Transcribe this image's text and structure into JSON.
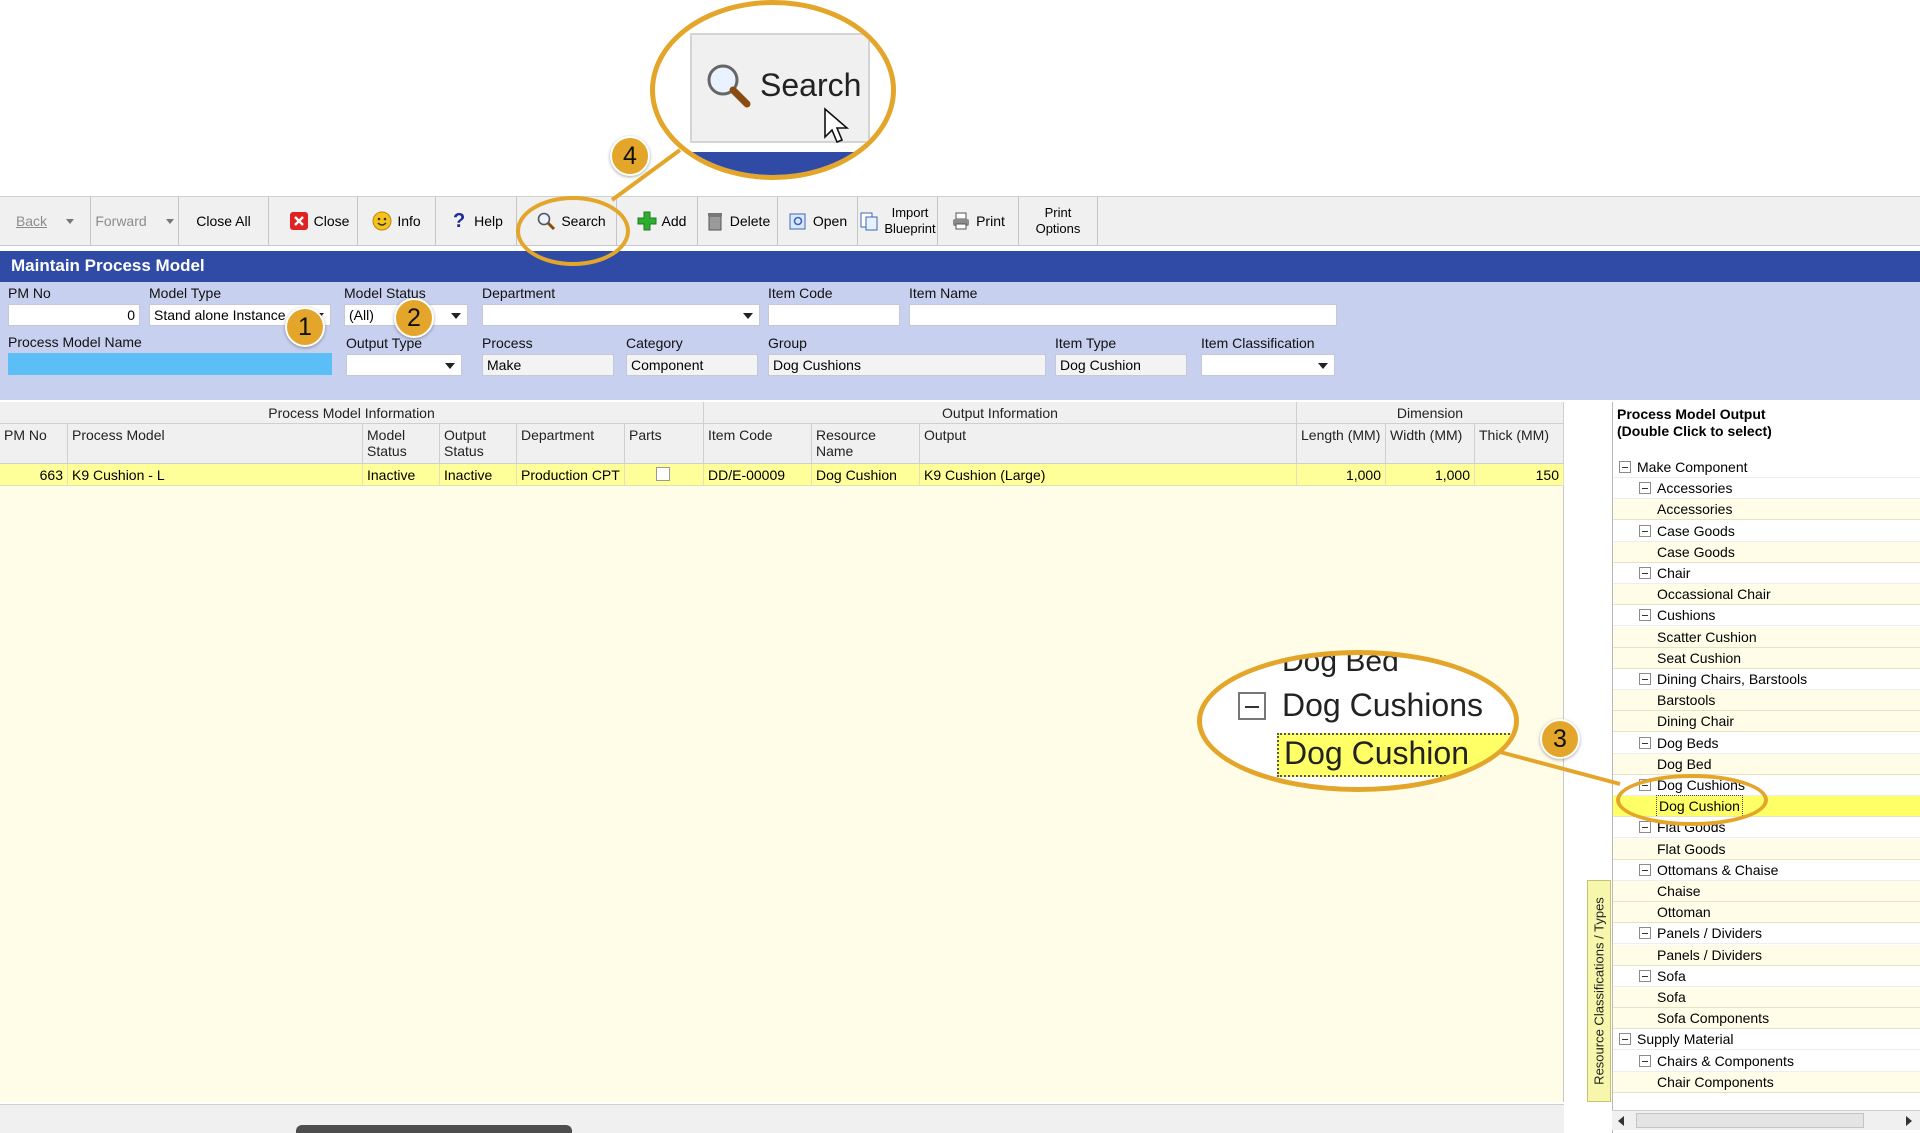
{
  "toolbar": {
    "back": "Back",
    "forward": "Forward",
    "close_all": "Close All",
    "close": "Close",
    "info": "Info",
    "help": "Help",
    "search": "Search",
    "add": "Add",
    "delete": "Delete",
    "open": "Open",
    "import_blueprint": [
      "Import",
      "Blueprint"
    ],
    "print": "Print",
    "print_options": [
      "Print",
      "Options"
    ]
  },
  "window_title": "Maintain Process Model",
  "filters": {
    "pm_no": {
      "label": "PM No",
      "value": "0"
    },
    "model_type": {
      "label": "Model Type",
      "value": "Stand alone Instance"
    },
    "model_status": {
      "label": "Model Status",
      "value": "(All)"
    },
    "department": {
      "label": "Department",
      "value": ""
    },
    "item_code": {
      "label": "Item Code",
      "value": ""
    },
    "item_name": {
      "label": "Item Name",
      "value": ""
    },
    "process_model_name": {
      "label": "Process Model Name",
      "value": ""
    },
    "output_type": {
      "label": "Output Type",
      "value": ""
    },
    "process": {
      "label": "Process",
      "value": "Make"
    },
    "category": {
      "label": "Category",
      "value": "Component"
    },
    "group": {
      "label": "Group",
      "value": "Dog Cushions"
    },
    "item_type": {
      "label": "Item Type",
      "value": "Dog Cushion"
    },
    "item_classification": {
      "label": "Item Classification",
      "value": ""
    }
  },
  "grid": {
    "band_headers": [
      "Process Model Information",
      "Output Information",
      "Dimension"
    ],
    "columns": [
      [
        "PM No"
      ],
      [
        "Process Model"
      ],
      [
        "Model",
        "Status"
      ],
      [
        "Output",
        "Status"
      ],
      [
        "Department"
      ],
      [
        "Parts"
      ],
      [
        "Item Code"
      ],
      [
        "Resource",
        "Name"
      ],
      [
        "Output"
      ],
      [
        "Length (MM)"
      ],
      [
        "Width (MM)"
      ],
      [
        "Thick (MM)"
      ]
    ],
    "rows": [
      {
        "pm_no": "663",
        "process_model": "K9 Cushion - L",
        "model_status": "Inactive",
        "output_status": "Inactive",
        "department": "Production CPT",
        "parts": false,
        "item_code": "DD/E-00009",
        "resource_name": "Dog Cushion",
        "output": "K9 Cushion (Large)",
        "length": "1,000",
        "width": "1,000",
        "thick": "150"
      }
    ]
  },
  "side_tab": "Resource Classifications / Types",
  "tree": {
    "title": [
      "Process Model Output",
      "(Double Click to select)"
    ],
    "nodes": [
      {
        "label": "Make Component",
        "level": 0,
        "type": "group"
      },
      {
        "label": "Accessories",
        "level": 1,
        "type": "group"
      },
      {
        "label": "Accessories",
        "level": 2,
        "type": "leaf"
      },
      {
        "label": "Case Goods",
        "level": 1,
        "type": "group"
      },
      {
        "label": "Case Goods",
        "level": 2,
        "type": "leaf"
      },
      {
        "label": "Chair",
        "level": 1,
        "type": "group"
      },
      {
        "label": "Occassional Chair",
        "level": 2,
        "type": "leaf"
      },
      {
        "label": "Cushions",
        "level": 1,
        "type": "group"
      },
      {
        "label": "Scatter Cushion",
        "level": 2,
        "type": "leaf"
      },
      {
        "label": "Seat Cushion",
        "level": 2,
        "type": "leaf"
      },
      {
        "label": "Dining Chairs, Barstools",
        "level": 1,
        "type": "group"
      },
      {
        "label": "Barstools",
        "level": 2,
        "type": "leaf"
      },
      {
        "label": "Dining Chair",
        "level": 2,
        "type": "leaf"
      },
      {
        "label": "Dog Beds",
        "level": 1,
        "type": "group"
      },
      {
        "label": "Dog Bed",
        "level": 2,
        "type": "leaf"
      },
      {
        "label": "Dog Cushions",
        "level": 1,
        "type": "group"
      },
      {
        "label": "Dog Cushion",
        "level": 2,
        "type": "leaf",
        "selected": true
      },
      {
        "label": "Flat Goods",
        "level": 1,
        "type": "group"
      },
      {
        "label": "Flat Goods",
        "level": 2,
        "type": "leaf"
      },
      {
        "label": "Ottomans & Chaise",
        "level": 1,
        "type": "group"
      },
      {
        "label": "Chaise",
        "level": 2,
        "type": "leaf"
      },
      {
        "label": "Ottoman",
        "level": 2,
        "type": "leaf"
      },
      {
        "label": "Panels / Dividers",
        "level": 1,
        "type": "group"
      },
      {
        "label": "Panels / Dividers",
        "level": 2,
        "type": "leaf"
      },
      {
        "label": "Sofa",
        "level": 1,
        "type": "group"
      },
      {
        "label": "Sofa",
        "level": 2,
        "type": "leaf"
      },
      {
        "label": "Sofa Components",
        "level": 2,
        "type": "leaf"
      },
      {
        "label": "Supply Material",
        "level": 0,
        "type": "group"
      },
      {
        "label": "Chairs & Components",
        "level": 1,
        "type": "group"
      },
      {
        "label": "Chair Components",
        "level": 2,
        "type": "leaf"
      }
    ]
  },
  "callouts": {
    "badges": [
      "1",
      "2",
      "3",
      "4"
    ],
    "zoom_search_label": "Search",
    "zoom_dog": {
      "top_partial": "Dog Bed",
      "group": "Dog Cushions",
      "leaf": "Dog Cushion"
    }
  },
  "colors": {
    "accent": "#2f4ba5",
    "filter_bg": "#c8d0f0",
    "row_highlight": "#ffff99",
    "callout": "#e3a62a"
  }
}
